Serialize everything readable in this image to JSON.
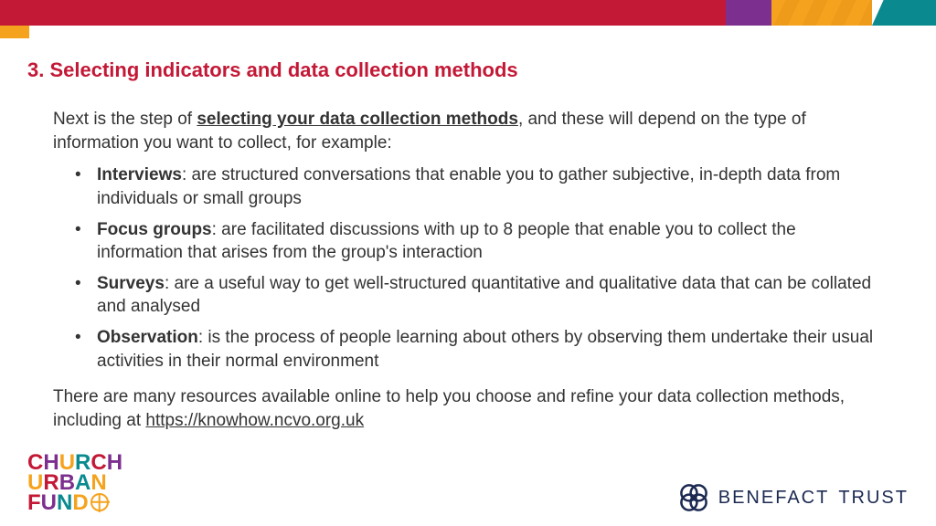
{
  "heading": "3. Selecting indicators and data collection methods",
  "intro_pre": "Next is the step of ",
  "intro_underline": "selecting your data collection methods",
  "intro_post": ", and these will depend on the type of information you want to collect, for example:",
  "methods": [
    {
      "term": "Interviews",
      "desc": ": are structured conversations that enable you to gather subjective, in-depth data from individuals or small groups"
    },
    {
      "term": "Focus groups",
      "desc": ": are facilitated discussions with up to 8 people that enable you to collect the information that arises from the group's interaction"
    },
    {
      "term": "Surveys",
      "desc": ": are a useful way to get well-structured quantitative and qualitative data that can be collated and analysed"
    },
    {
      "term": "Observation",
      "desc": ": is the process of people learning about others by observing them undertake their usual activities in their normal environment"
    }
  ],
  "outro_pre": "There are many resources available online to help you choose and refine your data collection methods, including at ",
  "outro_link": "https://knowhow.ncvo.org.uk",
  "logo_left": {
    "row1": [
      [
        "C",
        "c1"
      ],
      [
        "H",
        "c4"
      ],
      [
        "U",
        "c3"
      ],
      [
        "R",
        "c2"
      ],
      [
        "C",
        "c1"
      ],
      [
        "H",
        "c4"
      ]
    ],
    "row2": [
      [
        "U",
        "c3"
      ],
      [
        "R",
        "c1"
      ],
      [
        "B",
        "c4"
      ],
      [
        "A",
        "c2"
      ],
      [
        "N",
        "c3"
      ]
    ],
    "row3": [
      [
        "F",
        "c1"
      ],
      [
        "U",
        "c4"
      ],
      [
        "N",
        "c2"
      ],
      [
        "D",
        "c3"
      ]
    ]
  },
  "logo_right": {
    "word1": "BENEFACT",
    "word2": "TRUST"
  }
}
